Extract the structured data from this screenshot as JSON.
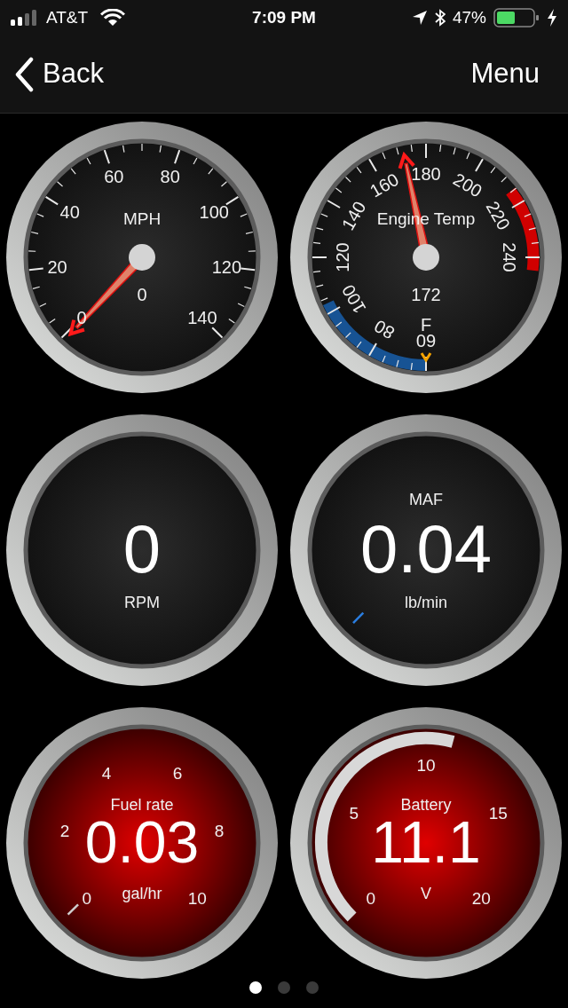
{
  "status_bar": {
    "carrier": "AT&T",
    "time": "7:09 PM",
    "battery_percent": "47%"
  },
  "nav": {
    "back": "Back",
    "menu": "Menu"
  },
  "gauge_rows": [
    {
      "gauges": [
        {
          "kind": "speedometer",
          "title": "MPH",
          "value": "0",
          "scale": [
            "0",
            "20",
            "40",
            "60",
            "80",
            "100",
            "120",
            "140"
          ]
        },
        {
          "kind": "temperature",
          "title": "Engine Temp",
          "value": "172",
          "unit": "F",
          "scale": [
            "60",
            "80",
            "100",
            "120",
            "140",
            "160",
            "180",
            "200",
            "220",
            "240"
          ]
        }
      ]
    },
    {
      "gauges": [
        {
          "kind": "counter",
          "value": "0",
          "unit": "RPM"
        },
        {
          "kind": "airflow",
          "title": "MAF",
          "value": "0.04",
          "unit": "lb/min"
        }
      ]
    },
    {
      "gauges": [
        {
          "kind": "rate_meter",
          "title": "Fuel rate",
          "value": "0.03",
          "unit": "gal/hr",
          "scale": [
            "0",
            "2",
            "4",
            "6",
            "8",
            "10"
          ]
        },
        {
          "kind": "voltmeter",
          "title": "Battery",
          "value": "11.1",
          "unit": "V",
          "scale": [
            "0",
            "5",
            "10",
            "15",
            "20"
          ]
        }
      ]
    }
  ],
  "pages": [
    {
      "selected": true
    },
    {
      "selected": false
    },
    {
      "selected": false
    }
  ]
}
